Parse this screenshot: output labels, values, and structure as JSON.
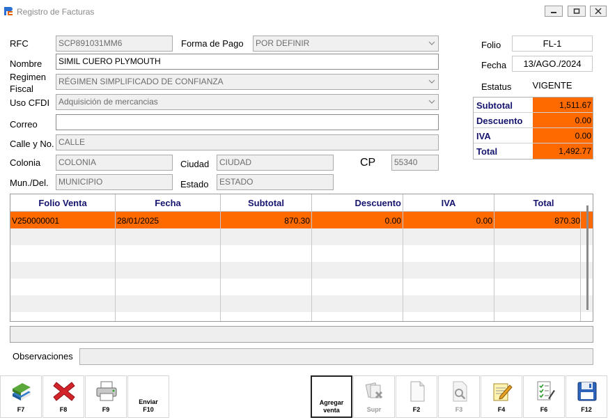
{
  "window": {
    "title": "Registro de Facturas"
  },
  "form": {
    "rfc_label": "RFC",
    "rfc_value": "SCP891031MM6",
    "forma_pago_label": "Forma de Pago",
    "forma_pago_value": "POR DEFINIR",
    "nombre_label": "Nombre",
    "nombre_value": "SIMIL CUERO PLYMOUTH",
    "regimen_label_1": "Regimen",
    "regimen_label_2": "Fiscal",
    "regimen_value": "RÉGIMEN SIMPLIFICADO DE CONFIANZA",
    "uso_cfdi_label": "Uso CFDI",
    "uso_cfdi_value": "Adquisición de mercancias",
    "correo_label": "Correo",
    "correo_value": "",
    "calle_label": "Calle y No.",
    "calle_value": "CALLE",
    "colonia_label": "Colonia",
    "colonia_value": "COLONIA",
    "ciudad_label": "Ciudad",
    "ciudad_value": "CIUDAD",
    "cp_label": "CP",
    "cp_value": "55340",
    "mun_label": "Mun./Del.",
    "mun_value": "MUNICIPIO",
    "estado_label": "Estado",
    "estado_value": "ESTADO"
  },
  "info": {
    "folio_label": "Folio",
    "folio_value": "FL-1",
    "fecha_label": "Fecha",
    "fecha_value": "13/AGO./2024",
    "estatus_label": "Estatus",
    "estatus_value": "VIGENTE"
  },
  "totals": [
    {
      "label": "Subtotal",
      "value": "1,511.67"
    },
    {
      "label": "Descuento",
      "value": "0.00"
    },
    {
      "label": "IVA",
      "value": "0.00"
    },
    {
      "label": "Total",
      "value": "1,492.77"
    }
  ],
  "grid": {
    "headers": [
      "Folio Venta",
      "Fecha",
      "Subtotal",
      "Descuento",
      "IVA",
      "Total"
    ],
    "rows": [
      [
        "V250000001",
        "28/01/2025",
        "870.30",
        "0.00",
        "0.00",
        "870.30"
      ]
    ]
  },
  "observaciones_label": "Observaciones",
  "toolbar": {
    "f7": "F7",
    "f8": "F8",
    "f9": "F9",
    "enviar_1": "Enviar",
    "enviar_2": "F10",
    "agregar_1": "Agregar",
    "agregar_2": "venta",
    "supr": "Supr",
    "f2": "F2",
    "f3": "F3",
    "f4": "F4",
    "f6": "F6",
    "f12": "F12"
  },
  "colors": {
    "accent": "#ff6a00",
    "header_text": "#15146e"
  }
}
